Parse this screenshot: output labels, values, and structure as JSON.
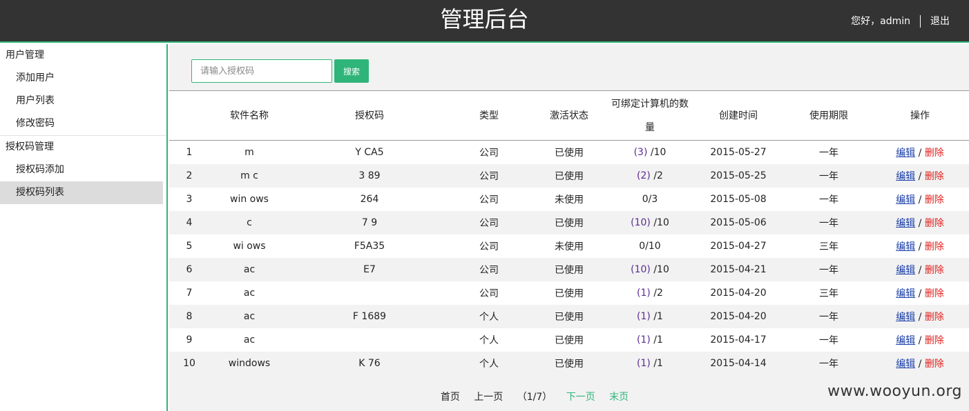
{
  "header": {
    "title": "管理后台",
    "greeting": "您好，admin",
    "logout": "退出"
  },
  "sidebar": {
    "groups": [
      {
        "title": "用户管理",
        "items": [
          {
            "label": "添加用户"
          },
          {
            "label": "用户列表"
          },
          {
            "label": "修改密码"
          }
        ]
      },
      {
        "title": "授权码管理",
        "items": [
          {
            "label": "授权码添加"
          },
          {
            "label": "授权码列表"
          }
        ]
      }
    ],
    "active_item": "授权码列表"
  },
  "search": {
    "placeholder": "请输入授权码",
    "button": "搜索"
  },
  "table": {
    "columns": [
      "",
      "软件名称",
      "授权码",
      "类型",
      "激活状态",
      "可绑定计算机的数量",
      "创建时间",
      "使用期限",
      "操作"
    ],
    "rows": [
      {
        "no": "1",
        "software": "m",
        "code": "Y CA5",
        "type": "公司",
        "status": "已使用",
        "bound": "(3)",
        "total": " /10",
        "created": "2015-05-27",
        "period": "一年"
      },
      {
        "no": "2",
        "software": "m c",
        "code": "3 89",
        "type": "公司",
        "status": "已使用",
        "bound": "(2)",
        "total": " /2",
        "created": "2015-05-25",
        "period": "一年"
      },
      {
        "no": "3",
        "software": "win ows",
        "code": "264",
        "type": "公司",
        "status": "未使用",
        "bound": "",
        "total": "0/3",
        "created": "2015-05-08",
        "period": "一年"
      },
      {
        "no": "4",
        "software": "c",
        "code": "7 9",
        "type": "公司",
        "status": "已使用",
        "bound": "(10)",
        "total": " /10",
        "created": "2015-05-06",
        "period": "一年"
      },
      {
        "no": "5",
        "software": "wi ows",
        "code": "F5A35",
        "type": "公司",
        "status": "未使用",
        "bound": "",
        "total": "0/10",
        "created": "2015-04-27",
        "period": "三年"
      },
      {
        "no": "6",
        "software": "ac",
        "code": "E7",
        "type": "公司",
        "status": "已使用",
        "bound": "(10)",
        "total": " /10",
        "created": "2015-04-21",
        "period": "一年"
      },
      {
        "no": "7",
        "software": "ac",
        "code": "",
        "type": "公司",
        "status": "已使用",
        "bound": "(1)",
        "total": " /2",
        "created": "2015-04-20",
        "period": "三年"
      },
      {
        "no": "8",
        "software": "ac",
        "code": "F 1689",
        "type": "个人",
        "status": "已使用",
        "bound": "(1)",
        "total": " /1",
        "created": "2015-04-20",
        "period": "一年"
      },
      {
        "no": "9",
        "software": "ac",
        "code": "",
        "type": "个人",
        "status": "已使用",
        "bound": "(1)",
        "total": " /1",
        "created": "2015-04-17",
        "period": "一年"
      },
      {
        "no": "10",
        "software": "windows",
        "code": "K 76",
        "type": "个人",
        "status": "已使用",
        "bound": "(1)",
        "total": " /1",
        "created": "2015-04-14",
        "period": "一年"
      }
    ],
    "actions": {
      "edit": "编辑",
      "sep": "/",
      "delete": "删除"
    }
  },
  "pager": {
    "first": "首页",
    "prev": "上一页",
    "info": "（1/7）",
    "next": "下一页",
    "last": "末页"
  },
  "watermark": "www.wooyun.org",
  "colors": {
    "accent": "#2fb579",
    "header_bg": "#333333",
    "bound_count": "#5a2d91",
    "edit_link": "#1a3fa8",
    "delete_link": "#e0201c"
  }
}
